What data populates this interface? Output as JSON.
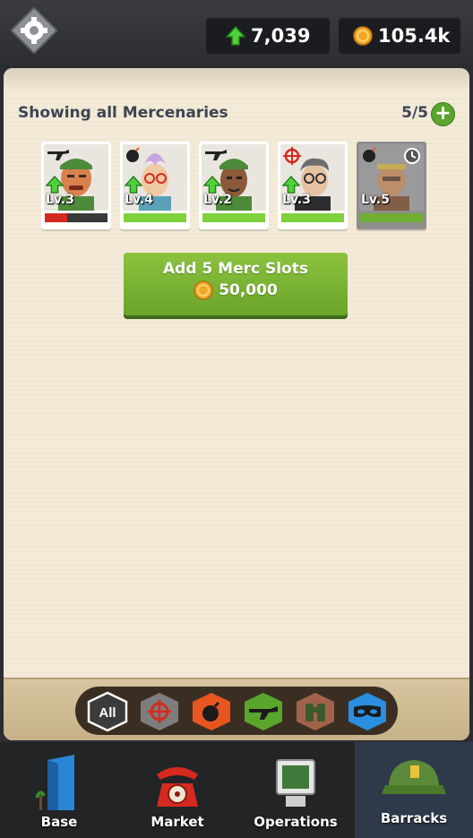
{
  "header": {
    "xp_value": "7,039",
    "coins_value": "105.4k"
  },
  "panel": {
    "showing_label": "Showing all Mercenaries",
    "slots_count": "5/5"
  },
  "mercenaries": [
    {
      "level": "Lv.3",
      "role": "rifle",
      "upgradable": true,
      "health": 0.35,
      "bar_color": "#d42a1f",
      "available": true
    },
    {
      "level": "Lv.4",
      "role": "bomb",
      "upgradable": true,
      "health": 1.0,
      "bar_color": "#7ed13a",
      "available": true
    },
    {
      "level": "Lv.2",
      "role": "rifle",
      "upgradable": true,
      "health": 1.0,
      "bar_color": "#7ed13a",
      "available": true
    },
    {
      "level": "Lv.3",
      "role": "sniper",
      "upgradable": true,
      "health": 1.0,
      "bar_color": "#7ed13a",
      "available": true
    },
    {
      "level": "Lv.5",
      "role": "bomb",
      "upgradable": false,
      "health": 1.0,
      "bar_color": "#6fae33",
      "available": false
    }
  ],
  "add_slots_button": {
    "title": "Add 5 Merc Slots",
    "price": "50,000"
  },
  "filters": [
    {
      "label": "All",
      "icon": "all-icon",
      "color": "#3b3b3b"
    },
    {
      "label": "",
      "icon": "crosshair-icon",
      "color": "#7d7d7d"
    },
    {
      "label": "",
      "icon": "bomb-icon",
      "color": "#e8561f"
    },
    {
      "label": "",
      "icon": "rifle-icon",
      "color": "#5aa52c"
    },
    {
      "label": "",
      "icon": "binoculars-icon",
      "color": "#a2624a"
    },
    {
      "label": "",
      "icon": "mask-icon",
      "color": "#2a8fe0"
    }
  ],
  "nav": {
    "base": "Base",
    "market": "Market",
    "operations": "Operations",
    "barracks": "Barracks",
    "active": "barracks"
  }
}
